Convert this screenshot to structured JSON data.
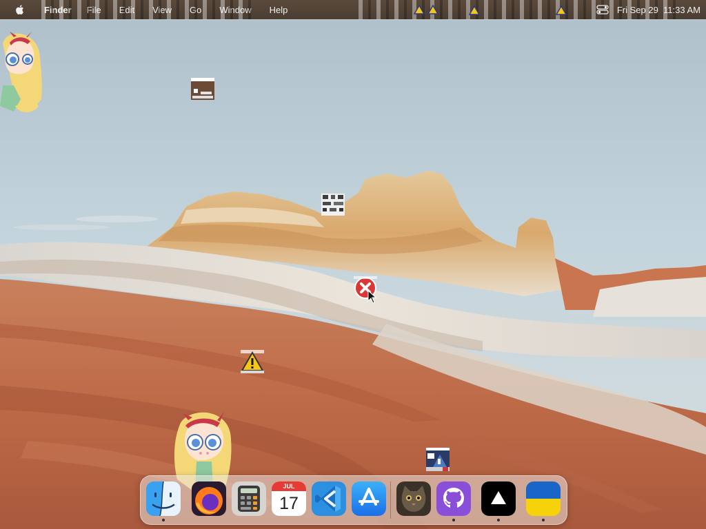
{
  "menubar": {
    "apple_icon": "apple-icon",
    "app_name": "Finder",
    "items": [
      "File",
      "Edit",
      "View",
      "Go",
      "Window",
      "Help"
    ],
    "status_icons": [
      "warning-icon",
      "warning-icon",
      "warning-icon",
      "warning-icon",
      "control-center-icon"
    ],
    "clock": "Fri Sep 29  11:33 AM"
  },
  "desktop": {
    "wallpaper": "desert-rock-formation",
    "objects": [
      {
        "name": "star-butterfly-sprite"
      },
      {
        "name": "broken-image-icon"
      },
      {
        "name": "broken-image-icon"
      },
      {
        "name": "error-icon"
      },
      {
        "name": "warning-icon"
      },
      {
        "name": "star-butterfly-sprite"
      },
      {
        "name": "broken-image-icon"
      }
    ]
  },
  "dock": {
    "apps": [
      {
        "name": "Finder",
        "icon": "finder-icon",
        "running": true
      },
      {
        "name": "Firefox",
        "icon": "firefox-icon",
        "running": false
      },
      {
        "name": "Calculator",
        "icon": "calculator-icon",
        "running": false
      },
      {
        "name": "Calendar",
        "icon": "calendar-icon",
        "running": false,
        "month": "JUL",
        "day": "17"
      },
      {
        "name": "Visual Studio Code",
        "icon": "vscode-icon",
        "running": false
      },
      {
        "name": "App Store",
        "icon": "app-store-icon",
        "running": false
      },
      {
        "name": "Cat Photo",
        "icon": "cat-icon",
        "running": false
      },
      {
        "name": "GitHub Desktop",
        "icon": "github-icon",
        "running": true
      },
      {
        "name": "Vercel",
        "icon": "vercel-icon",
        "running": true
      },
      {
        "name": "Ukraine",
        "icon": "ukraine-flag-icon",
        "running": true
      }
    ]
  },
  "colors": {
    "menubar": "#4e4034",
    "sky": "#b9cdd8",
    "sand": "#c2714e",
    "rock": "#e2d6c6"
  }
}
